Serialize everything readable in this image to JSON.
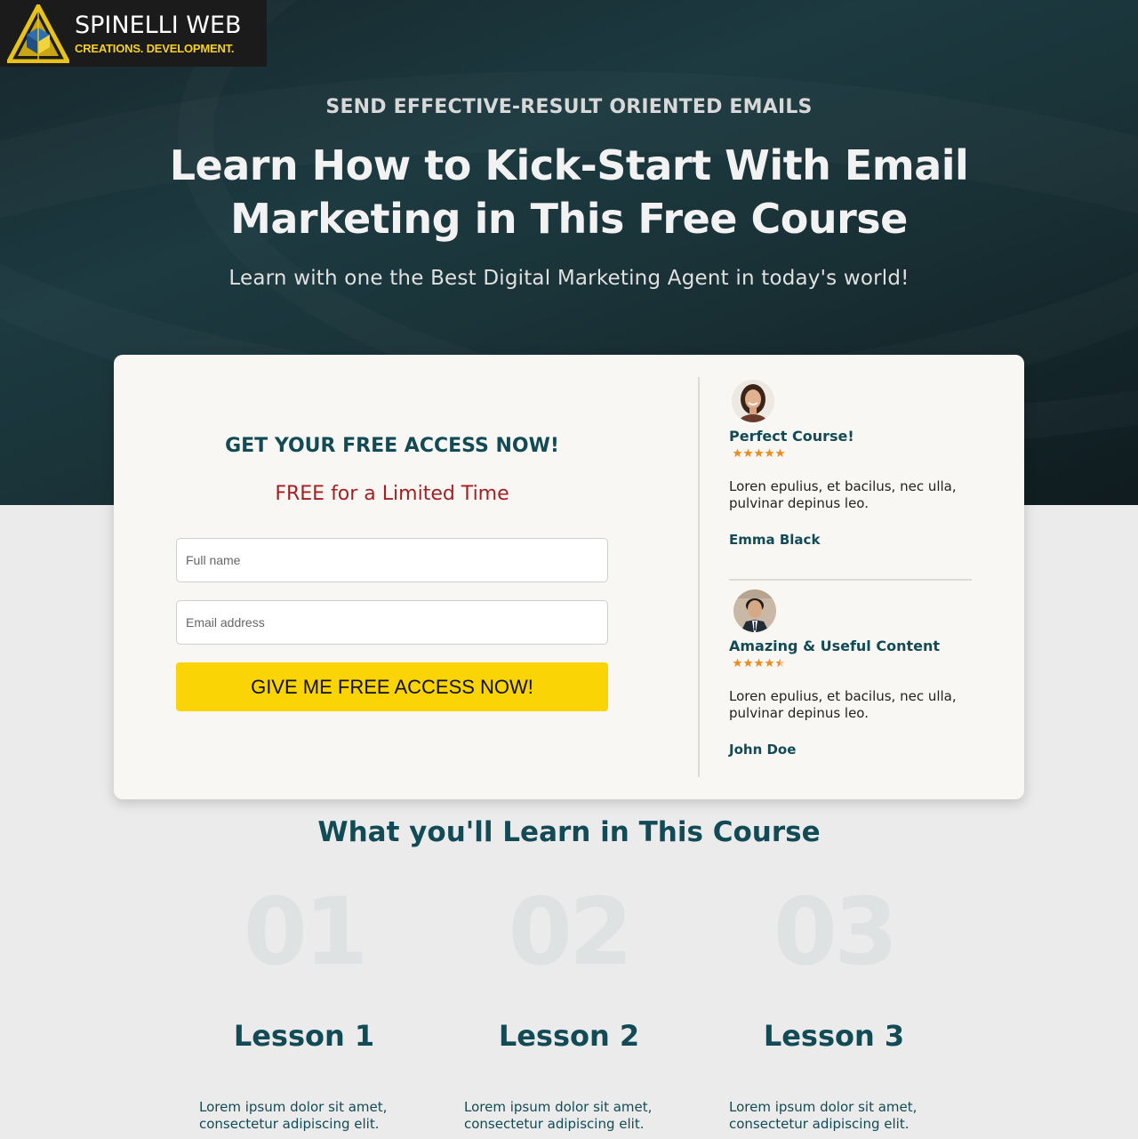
{
  "brand": {
    "title": "SPINELLI WEB",
    "tagline": "CREATIONS. DEVELOPMENT."
  },
  "hero": {
    "eyebrow": "SEND EFFECTIVE-RESULT ORIENTED EMAILS",
    "headline": "Learn How to Kick-Start With Email Marketing in This Free Course",
    "subline": "Learn with one the Best Digital Marketing Agent in today's world!"
  },
  "signup": {
    "title": "GET YOUR FREE ACCESS NOW!",
    "free_note": "FREE for a Limited Time",
    "name_placeholder": "Full name",
    "email_placeholder": "Email address",
    "submit_label": "GIVE ME FREE ACCESS NOW!"
  },
  "reviews": [
    {
      "title": "Perfect Course!",
      "rating": 5,
      "text": "Loren epulius, et bacilus, nec ulla, pulvinar depinus leo.",
      "author": "Emma Black"
    },
    {
      "title": "Amazing & Useful Content",
      "rating": 4.5,
      "text": "Loren epulius, et bacilus, nec ulla, pulvinar depinus leo.",
      "author": "John Doe"
    }
  ],
  "course": {
    "section_title": "What you'll Learn in This Course",
    "lessons": [
      {
        "number": "01",
        "title": "Lesson 1",
        "text": "Lorem ipsum dolor sit amet, consectetur adipiscing elit."
      },
      {
        "number": "02",
        "title": "Lesson 2",
        "text": "Lorem ipsum dolor sit amet, consectetur adipiscing elit."
      },
      {
        "number": "03",
        "title": "Lesson 3",
        "text": "Lorem ipsum dolor sit amet, consectetur adipiscing elit."
      }
    ]
  },
  "colors": {
    "brand_teal": "#124b55",
    "accent_red": "#a51e22",
    "cta_yellow": "#fbd405",
    "star_orange": "#f08c1a",
    "logo_gold": "#f6d21e"
  },
  "icons": {
    "logo": "triangle-cube-logo-icon",
    "star": "star-icon",
    "half_star": "half-star-icon"
  }
}
